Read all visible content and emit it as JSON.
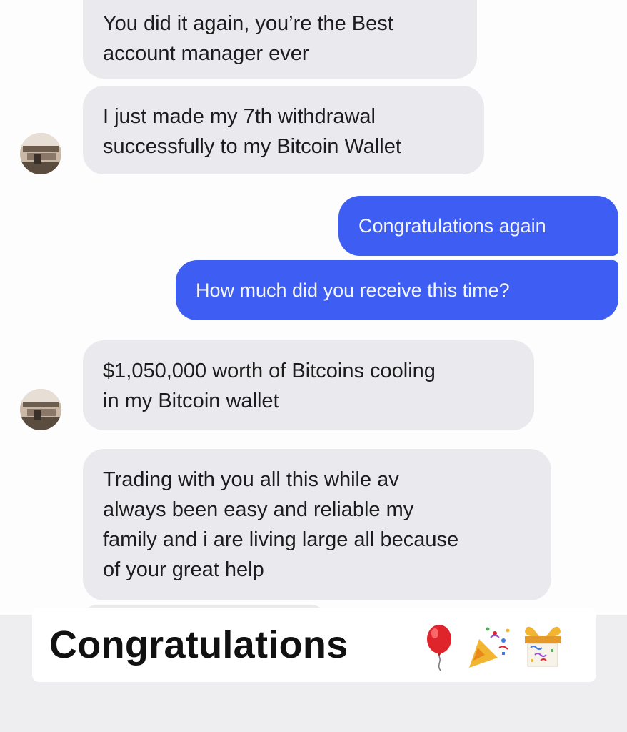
{
  "conversation": {
    "messages": [
      {
        "direction": "incoming",
        "lines": [
          "You did it again, you’re the Best",
          "account manager ever"
        ]
      },
      {
        "direction": "incoming",
        "lines": [
          "I just made my 7th withdrawal",
          "successfully to my Bitcoin Wallet"
        ]
      },
      {
        "direction": "outgoing",
        "lines": [
          "Congratulations again"
        ]
      },
      {
        "direction": "outgoing",
        "lines": [
          "How much did you receive this time?"
        ]
      },
      {
        "direction": "incoming",
        "lines": [
          "$1,050,000 worth of Bitcoins cooling",
          "in my Bitcoin wallet"
        ]
      },
      {
        "direction": "incoming",
        "lines": [
          "Trading with you all this while av",
          "always been easy and reliable my",
          "family and i are living large all because",
          "of your great help"
        ]
      }
    ]
  },
  "caption": {
    "text": "Congratulations",
    "emojis": [
      "balloon-icon",
      "party-popper-icon",
      "gift-icon"
    ]
  },
  "colors": {
    "incoming_bubble": "#eaeaee",
    "outgoing_bubble": "#3e5df2",
    "caption_bg": "#ffffff"
  }
}
